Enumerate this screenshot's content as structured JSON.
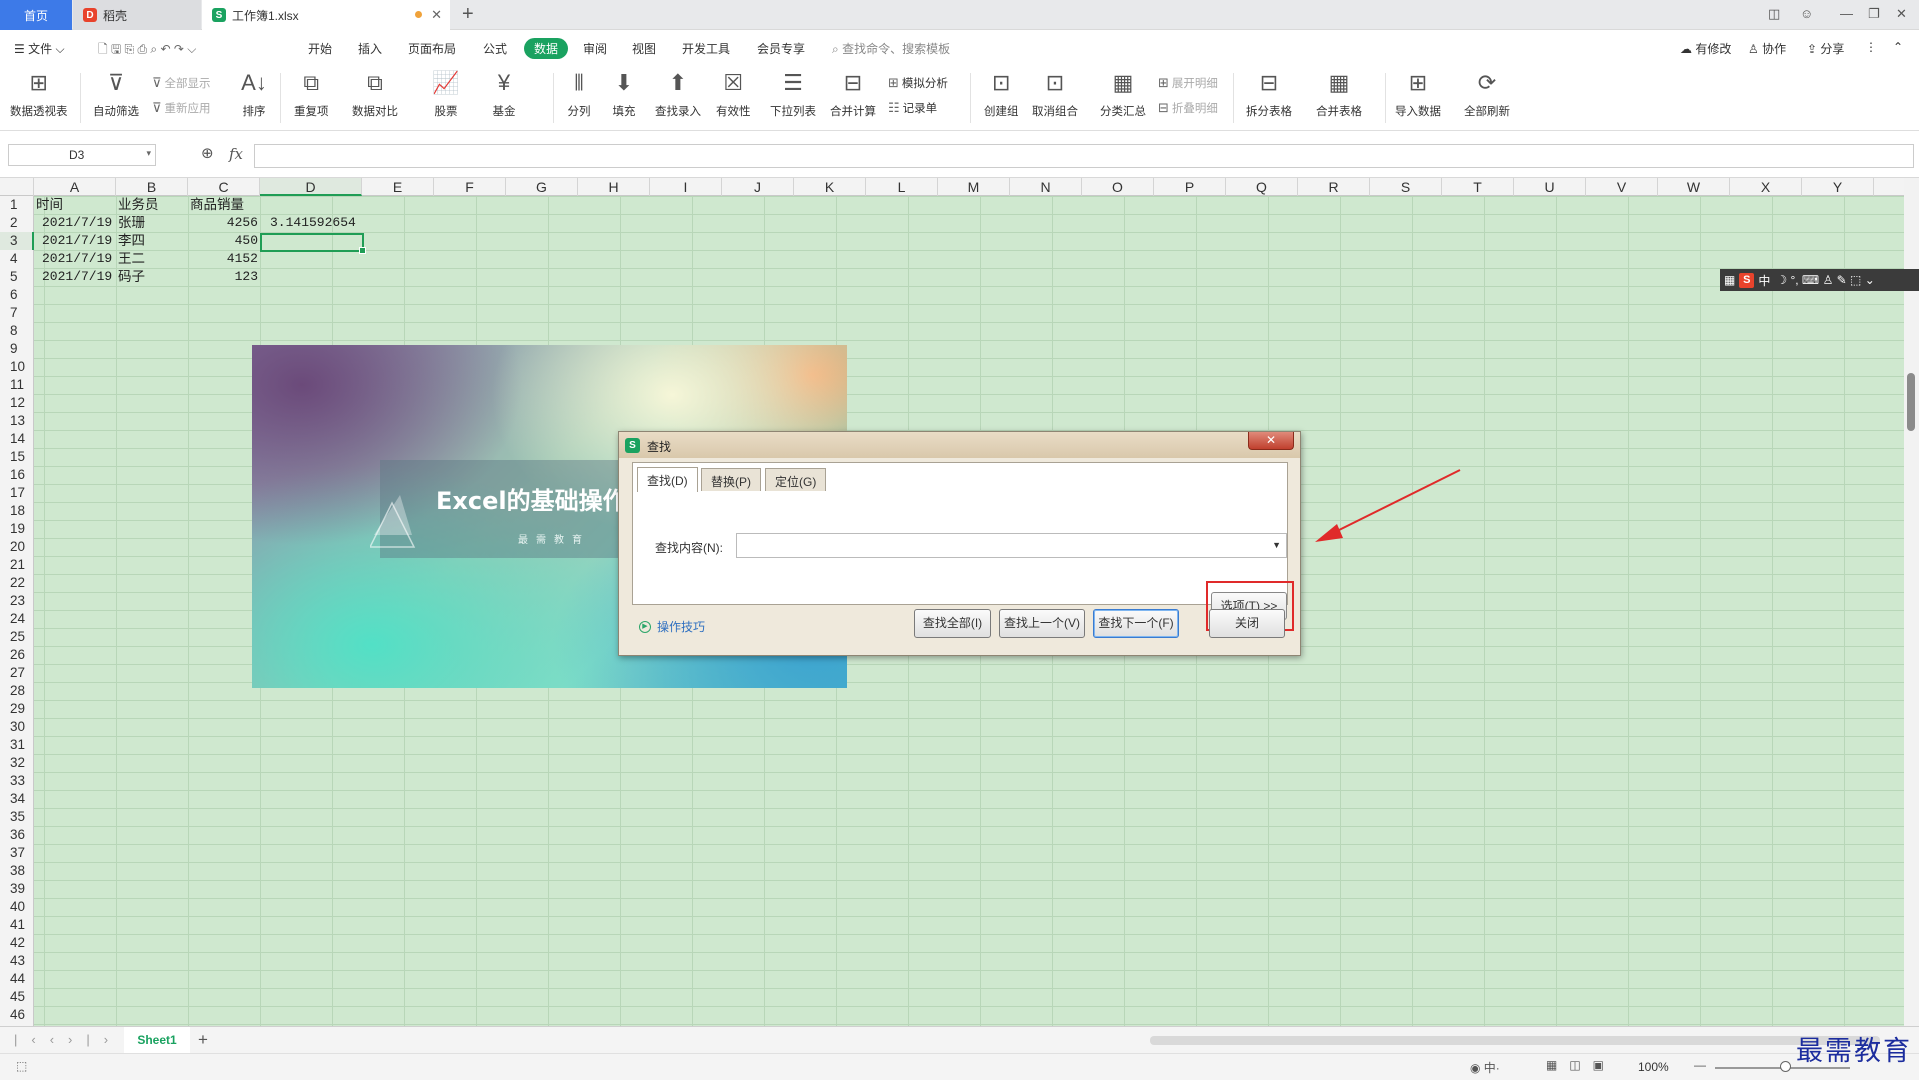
{
  "tabs": {
    "home": "首页",
    "daoke": "稻壳",
    "book": "工作簿1.xlsx"
  },
  "menu": {
    "file": "文件",
    "items": [
      "开始",
      "插入",
      "页面布局",
      "公式",
      "数据",
      "审阅",
      "视图",
      "开发工具",
      "会员专享"
    ],
    "search_placeholder": "查找命令、搜索模板",
    "has_changes": "有修改",
    "collab": "协作",
    "share": "分享"
  },
  "ribbon": {
    "pivot": "数据透视表",
    "autofilter": "自动筛选",
    "show_all": "全部显示",
    "reapply": "重新应用",
    "sort": "排序",
    "dup": "重复项",
    "compare": "数据对比",
    "stock": "股票",
    "fund": "基金",
    "split": "分列",
    "fill": "填充",
    "lookup": "查找录入",
    "validity": "有效性",
    "dropdown": "下拉列表",
    "consolidate": "合并计算",
    "whatif": "模拟分析",
    "record": "记录单",
    "group": "创建组",
    "ungroup": "取消组合",
    "subtotal": "分类汇总",
    "expand": "展开明细",
    "collapse": "折叠明细",
    "split_table": "拆分表格",
    "merge_table": "合并表格",
    "import": "导入数据",
    "refresh_all": "全部刷新"
  },
  "namebox": "D3",
  "fx": "fx",
  "columns": [
    "A",
    "B",
    "C",
    "D",
    "E",
    "F",
    "G",
    "H",
    "I",
    "J",
    "K",
    "L",
    "M",
    "N",
    "O",
    "P",
    "Q",
    "R",
    "S",
    "T",
    "U",
    "V",
    "W",
    "X",
    "Y"
  ],
  "rows": [
    "1",
    "2",
    "3",
    "4",
    "5",
    "6",
    "7",
    "8",
    "9",
    "10",
    "11",
    "12",
    "13",
    "14",
    "15",
    "16",
    "17",
    "18",
    "19",
    "20",
    "21",
    "22",
    "23",
    "24",
    "25",
    "26",
    "27",
    "28",
    "29",
    "30",
    "31",
    "32",
    "33",
    "34",
    "35",
    "36",
    "37",
    "38",
    "39",
    "40",
    "41",
    "42",
    "43",
    "44",
    "45",
    "46"
  ],
  "sheet": {
    "headers": {
      "a": "时间",
      "b": "业务员",
      "c": "商品销量"
    },
    "r2": {
      "a": "2021/7/19",
      "b": "张珊",
      "c": "4256",
      "d": "3.141592654"
    },
    "r3": {
      "a": "2021/7/19",
      "b": "李四",
      "c": "450"
    },
    "r4": {
      "a": "2021/7/19",
      "b": "王二",
      "c": "4152"
    },
    "r5": {
      "a": "2021/7/19",
      "b": "码子",
      "c": "123"
    }
  },
  "banner": {
    "title": "Excel的基础操作",
    "subtitle": "最需教育"
  },
  "dialog": {
    "title": "查找",
    "tab_find": "查找(D)",
    "tab_replace": "替换(P)",
    "tab_goto": "定位(G)",
    "find_label": "查找内容(N):",
    "find_value": "",
    "options": "选项(T) >>",
    "tips": "操作技巧",
    "find_all": "查找全部(I)",
    "find_prev": "查找上一个(V)",
    "find_next": "查找下一个(F)",
    "close": "关闭"
  },
  "ime": {
    "lang": "中"
  },
  "sheet_tab": "Sheet1",
  "status": {
    "zoom": "100%"
  },
  "watermark": "最需教育",
  "colors": {
    "accent": "#1aa260",
    "grid_bg": "#cfe8cf",
    "highlight": "#e02a2a"
  }
}
